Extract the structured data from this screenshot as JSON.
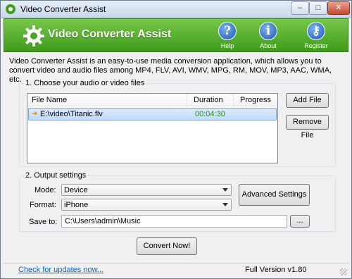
{
  "window": {
    "title": "Video Converter Assist",
    "controls": {
      "minimize": "–",
      "maximize": "□",
      "close": "✕"
    }
  },
  "header": {
    "title": "Video Converter Assist",
    "logo_icon": "gear-icon",
    "tools": [
      {
        "label": "Help",
        "icon": "question-icon",
        "glyph": "?"
      },
      {
        "label": "About",
        "icon": "info-icon",
        "glyph": "i"
      },
      {
        "label": "Register",
        "icon": "key-icon",
        "glyph": "⚷"
      }
    ],
    "colors": {
      "banner_top": "#78c64a",
      "banner_bottom": "#3f9c1c"
    }
  },
  "intro": "Video Converter Assist is an easy-to-use media conversion application, which allows you to convert video and audio files among MP4, FLV, AVI, WMV, MPG, RM, MOV, MP3, AAC, WMA, etc.",
  "section1": {
    "title": "1. Choose your audio or video files",
    "columns": {
      "name": "File Name",
      "duration": "Duration",
      "progress": "Progress"
    },
    "files": [
      {
        "name": "E:\\video\\Titanic.flv",
        "duration": "00:04:30",
        "progress": ""
      }
    ],
    "add_button": "Add File",
    "remove_button": "Remove File"
  },
  "section2": {
    "title": "2. Output settings",
    "mode_label": "Mode:",
    "mode_value": "Device",
    "format_label": "Format:",
    "format_value": "iPhone",
    "save_label": "Save to:",
    "save_value": "C:\\Users\\admin\\Music",
    "advanced_button": "Advanced Settings",
    "browse_button": "..."
  },
  "convert_button": "Convert Now!",
  "footer": {
    "update_link": "Check for updates now...",
    "version": "Full Version v1.80"
  }
}
